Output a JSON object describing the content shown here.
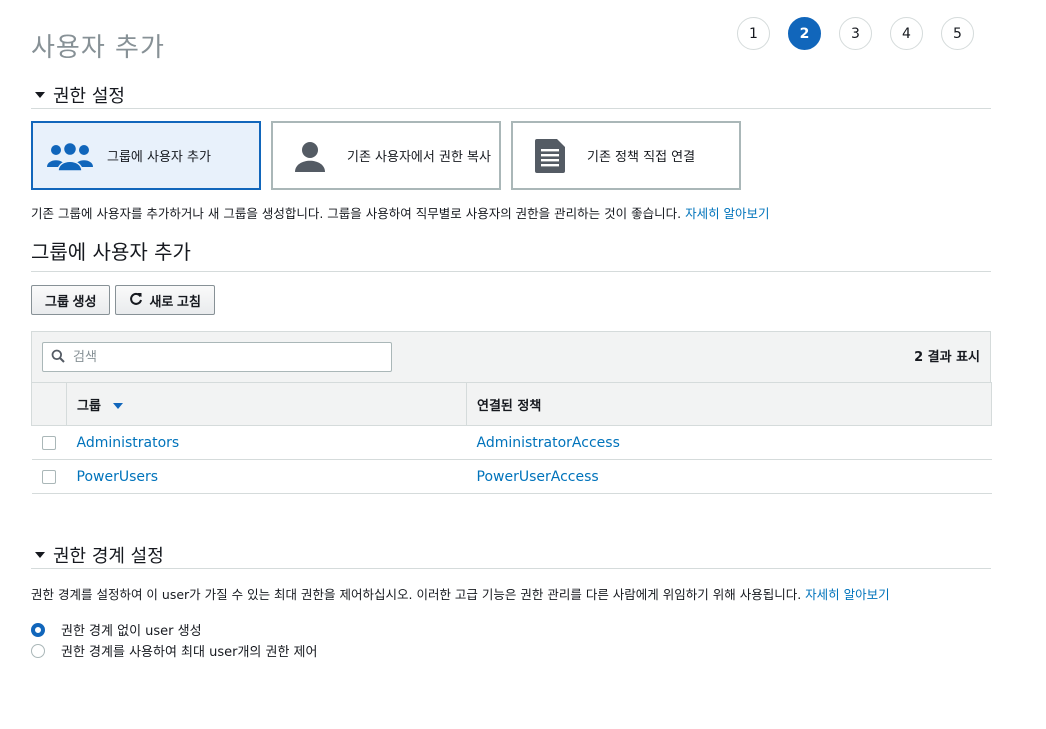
{
  "page": {
    "title": "사용자 추가"
  },
  "steps": [
    {
      "label": "1",
      "active": false
    },
    {
      "label": "2",
      "active": true
    },
    {
      "label": "3",
      "active": false
    },
    {
      "label": "4",
      "active": false
    },
    {
      "label": "5",
      "active": false
    }
  ],
  "permissions": {
    "section_title": "권한 설정",
    "options": [
      {
        "label": "그룹에 사용자 추가",
        "icon": "users-group-icon",
        "selected": true
      },
      {
        "label": "기존 사용자에서 권한 복사",
        "icon": "user-icon",
        "selected": false
      },
      {
        "label": "기존 정책 직접 연결",
        "icon": "document-icon",
        "selected": false
      }
    ],
    "description": "기존 그룹에 사용자를 추가하거나 새 그룹을 생성합니다. 그룹을 사용하여 직무별로 사용자의 권한을 관리하는 것이 좋습니다.",
    "learn_more": "자세히 알아보기"
  },
  "groups": {
    "title": "그룹에 사용자 추가",
    "create_group_label": "그룹 생성",
    "refresh_label": "새로 고침",
    "search_placeholder": "검색",
    "result_count": "2 결과 표시",
    "columns": {
      "group": "그룹",
      "policy": "연결된 정책"
    },
    "rows": [
      {
        "group": "Administrators",
        "policy": "AdministratorAccess"
      },
      {
        "group": "PowerUsers",
        "policy": "PowerUserAccess"
      }
    ]
  },
  "boundary": {
    "section_title": "권한 경계 설정",
    "description": "권한 경계를 설정하여 이 user가 가질 수 있는 최대 권한을 제어하십시오. 이러한 고급 기능은 권한 관리를 다른 사람에게 위임하기 위해 사용됩니다.",
    "learn_more": "자세히 알아보기",
    "options": [
      {
        "label": "권한 경계 없이 user 생성",
        "checked": true
      },
      {
        "label": "권한 경계를 사용하여 최대 user개의 권한 제어",
        "checked": false
      }
    ]
  },
  "colors": {
    "accent": "#1166bb",
    "link": "#0073bb",
    "icon_gray": "#545b64"
  }
}
